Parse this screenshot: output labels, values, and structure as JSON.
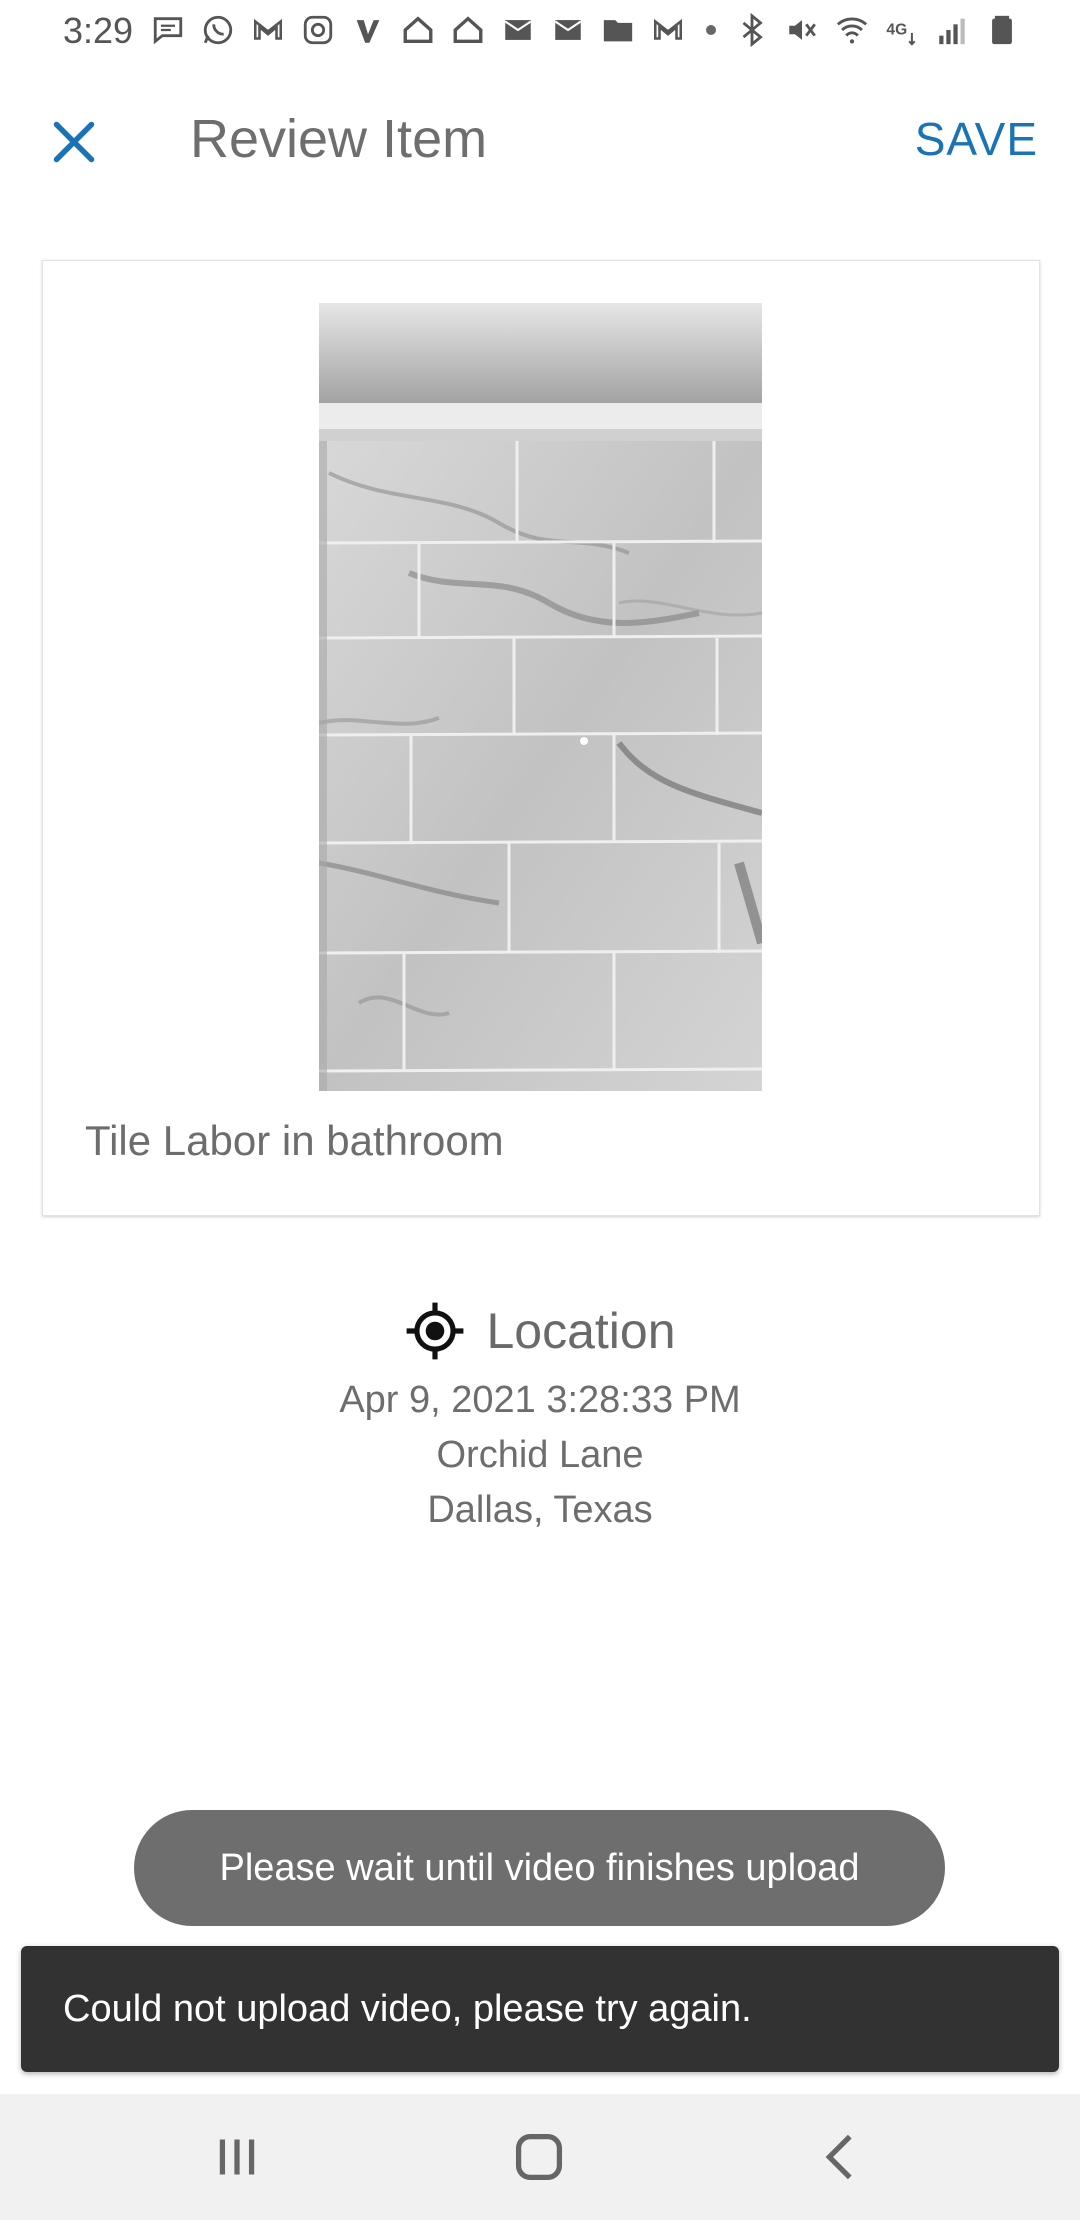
{
  "status_bar": {
    "time": "3:29",
    "left_icons": [
      "message-icon",
      "whatsapp-icon",
      "gmail-icon",
      "instagram-icon",
      "venmo-icon",
      "home-icon",
      "home-icon",
      "email-icon",
      "email-icon",
      "folder-icon",
      "gmail-icon",
      "dot-icon"
    ],
    "right_icons": [
      "bluetooth-icon",
      "mute-icon",
      "wifi-icon",
      "4g-lte-icon",
      "signal-icon",
      "battery-icon"
    ]
  },
  "app_bar": {
    "title": "Review Item",
    "save_label": "SAVE",
    "accent_color": "#1a73b5"
  },
  "card": {
    "caption": "Tile Labor in bathroom"
  },
  "location": {
    "label": "Location",
    "timestamp": "Apr 9, 2021 3:28:33 PM",
    "street": "Orchid Lane",
    "city": "Dallas, Texas"
  },
  "toast": {
    "message": "Please wait until video finishes upload"
  },
  "snackbar": {
    "message": "Could not upload video, please try again."
  },
  "nav_bar": {
    "items": [
      "recents-icon",
      "home-icon",
      "back-icon"
    ]
  }
}
